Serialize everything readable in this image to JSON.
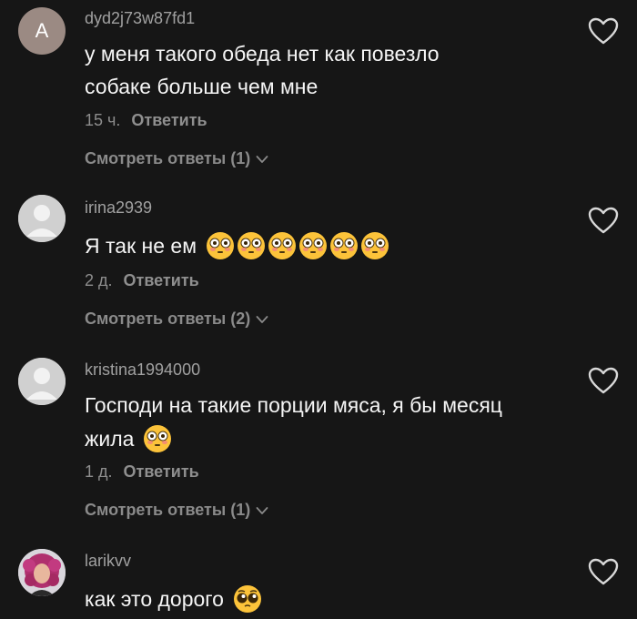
{
  "colors": {
    "background": "#161616",
    "username": "#a0a0a0",
    "text": "#f5f5f5",
    "meta": "#8d8d8d",
    "emoji_face": "#fcc33a"
  },
  "comments": [
    {
      "avatar_letter": "A",
      "username": "dyd2j73w87fd1",
      "lines": [
        "у меня такого обеда нет как повезло",
        "собаке больше чем мне"
      ],
      "time": "15 ч.",
      "reply_label": "Ответить",
      "view_replies": "Смотреть ответы (1)",
      "emoji_icon": null
    },
    {
      "avatar_icon": "default-avatar-icon",
      "username": "irina2939",
      "lines": [
        "Я так не ем"
      ],
      "emoji_icon": "flushed-face-icon",
      "emoji_count": 6,
      "time": "2 д.",
      "reply_label": "Ответить",
      "view_replies": "Смотреть ответы (2)"
    },
    {
      "avatar_icon": "default-avatar-icon",
      "username": "kristina1994000",
      "lines": [
        "Господи на такие порции мяса, я бы месяц",
        "жила"
      ],
      "emoji_icon": "flushed-face-icon",
      "emoji_count": 1,
      "time": "1 д.",
      "reply_label": "Ответить",
      "view_replies": "Смотреть ответы (1)"
    },
    {
      "avatar_icon": "photo-avatar-icon",
      "username": "larikvv",
      "lines": [
        "как это дорого"
      ],
      "emoji_icon": "pleading-face-icon",
      "emoji_count": 1
    }
  ]
}
